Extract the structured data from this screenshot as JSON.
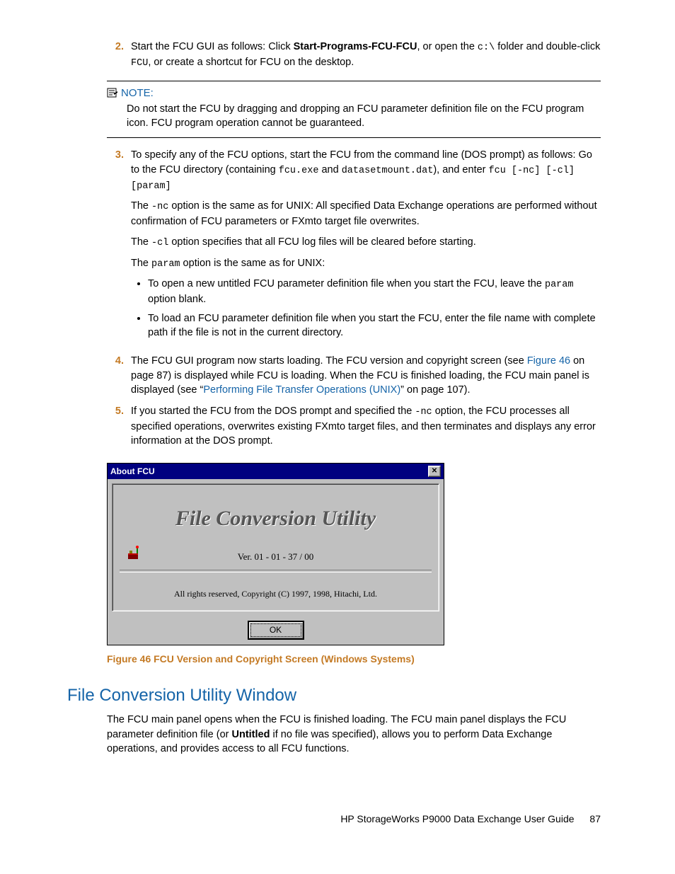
{
  "steps": {
    "s2": {
      "num": "2.",
      "pre": "Start the FCU GUI as follows: Click ",
      "bold": "Start-Programs-FCU-FCU",
      "mid1": ", or open the ",
      "code": "c:\\",
      "mid2": " folder and double-click ",
      "code2": "FCU",
      "post": ", or create a shortcut for FCU on the desktop."
    },
    "note": {
      "label": "NOTE:",
      "body": "Do not start the FCU by dragging and dropping an FCU parameter definition file on the FCU program icon. FCU program operation cannot be guaranteed."
    },
    "s3": {
      "num": "3.",
      "line1": "To specify any of the FCU options, start the FCU from the command line (DOS prompt) as follows: Go to the FCU directory (containing ",
      "c1": "fcu.exe",
      "m1": " and ",
      "c2": "datasetmount.dat",
      "m2": "), and enter ",
      "c3": "fcu [-nc] [-cl] [param]",
      "p2a": "The ",
      "p2c": "-nc",
      "p2b": " option is the same as for UNIX: All specified Data Exchange operations are performed without confirmation of FCU parameters or FXmto target file overwrites.",
      "p3a": "The ",
      "p3c": "-cl",
      "p3b": " option specifies that all FCU log files will be cleared before starting.",
      "p4a": "The ",
      "p4c": "param",
      "p4b": " option is the same as for UNIX:",
      "b1a": "To open a new untitled FCU parameter definition file when you start the FCU, leave the ",
      "b1c": "param",
      "b1b": " option blank.",
      "b2": "To load an FCU parameter definition file when you start the FCU, enter the file name with complete path if the file is not in the current directory."
    },
    "s4": {
      "num": "4.",
      "a": "The FCU GUI program now starts loading. The FCU version and copyright screen (see ",
      "link1": "Figure 46",
      "b": " on page 87) is displayed while FCU is loading. When the FCU is finished loading, the FCU main panel is displayed (see “",
      "link2": "Performing File Transfer Operations (UNIX)",
      "c": "” on page 107)."
    },
    "s5": {
      "num": "5.",
      "a": "If you started the FCU from the DOS prompt and specified the ",
      "code": "-nc",
      "b": " option, the FCU processes all specified operations, overwrites existing FXmto target files, and then terminates and displays any error information at the DOS prompt."
    }
  },
  "dialog": {
    "title": "About FCU",
    "heading": "File Conversion Utility",
    "version": "Ver.  01 - 01 - 37 / 00",
    "copyright": "All rights reserved, Copyright (C) 1997, 1998, Hitachi, Ltd.",
    "ok": "OK",
    "close": "✕"
  },
  "caption": "Figure 46 FCU Version and Copyright Screen (Windows Systems)",
  "section": {
    "title": "File Conversion Utility Window",
    "p1a": "The FCU main panel opens when the FCU is finished loading. The FCU main panel displays the FCU parameter definition file (or ",
    "p1b": "Untitled",
    "p1c": " if no file was specified), allows you to perform Data Exchange operations, and provides access to all FCU functions."
  },
  "footer": {
    "title": "HP StorageWorks P9000 Data Exchange User Guide",
    "page": "87"
  }
}
